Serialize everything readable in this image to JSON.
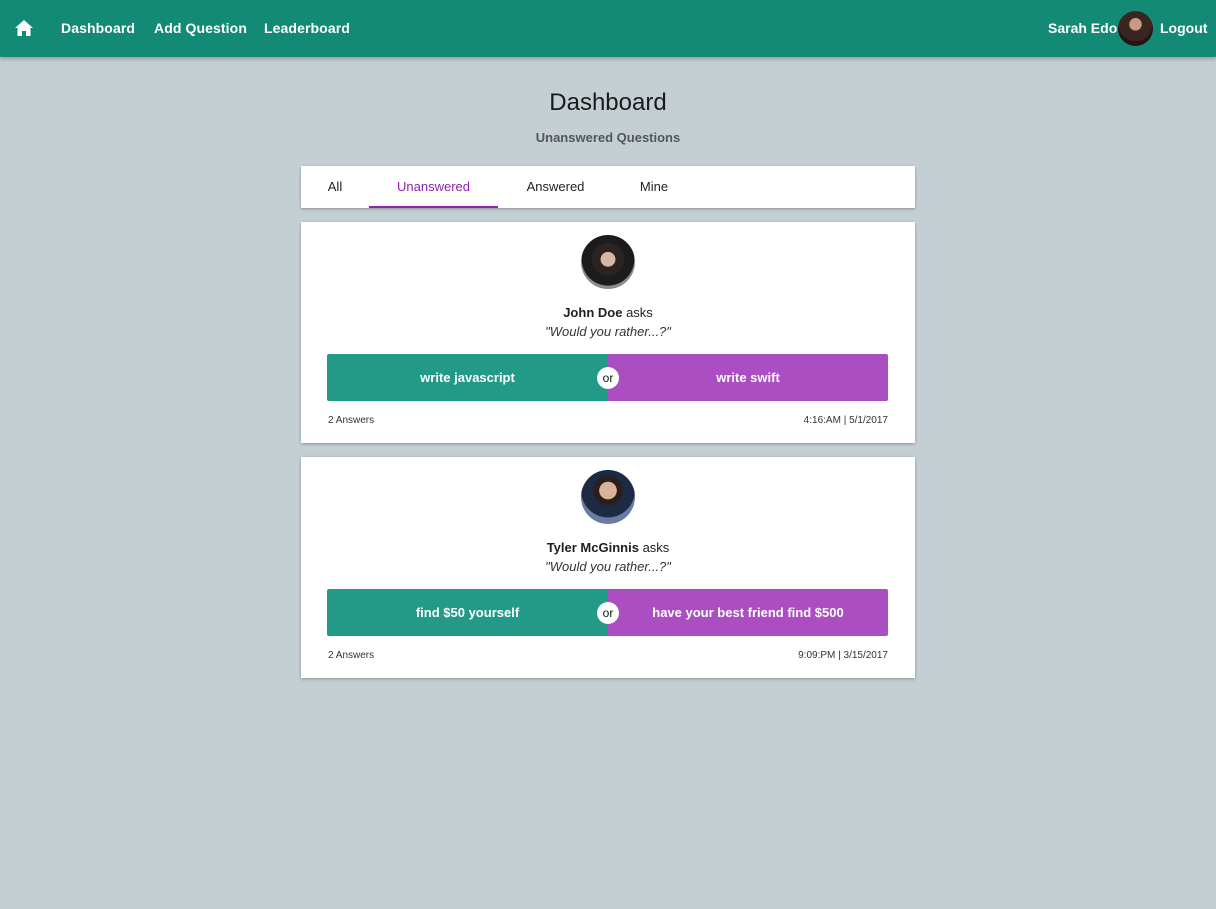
{
  "nav": {
    "links": [
      "Dashboard",
      "Add Question",
      "Leaderboard"
    ],
    "user_name": "Sarah Edo",
    "logout": "Logout",
    "home_icon": "home-icon"
  },
  "page": {
    "title": "Dashboard",
    "subtitle": "Unanswered Questions"
  },
  "tabs": [
    "All",
    "Unanswered",
    "Answered",
    "Mine"
  ],
  "active_tab": "Unanswered",
  "colors": {
    "topbar": "#138a76",
    "option_a": "#239a87",
    "option_b": "#ab4ec1",
    "accent": "#8e24aa",
    "background": "#c4cfd4"
  },
  "questions": [
    {
      "author": "John Doe",
      "asks": "asks",
      "prompt": "\"Would you rather...?\"",
      "option_a": "write javascript",
      "or": "or",
      "option_b": "write swift",
      "answers": "2 Answers",
      "timestamp": "4:16:AM | 5/1/2017"
    },
    {
      "author": "Tyler McGinnis",
      "asks": "asks",
      "prompt": "\"Would you rather...?\"",
      "option_a": "find $50 yourself",
      "or": "or",
      "option_b": "have your best friend find $500",
      "answers": "2 Answers",
      "timestamp": "9:09:PM | 3/15/2017"
    }
  ]
}
